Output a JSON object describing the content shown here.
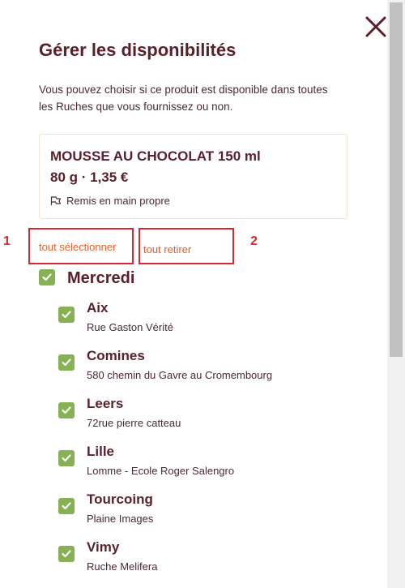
{
  "panel": {
    "title": "Gérer les disponibilités",
    "description": "Vous pouvez choisir si ce produit est disponible dans toutes les Ruches que vous fournissez ou non."
  },
  "product": {
    "name": "MOUSSE AU CHOCOLAT 150 ml",
    "price": "80 g · 1,35 €",
    "delivery": "Remis en main propre"
  },
  "actions": {
    "select_all": "tout sélectionner",
    "remove_all": "tout retirer"
  },
  "annotations": [
    "1",
    "2"
  ],
  "day": {
    "label": "Mercredi",
    "checked": true
  },
  "hives": [
    {
      "name": "Aix",
      "address": "Rue Gaston Vérité",
      "checked": true
    },
    {
      "name": "Comines",
      "address": "580 chemin du Gavre au Cromembourg",
      "checked": true
    },
    {
      "name": "Leers",
      "address": "72rue pierre catteau",
      "checked": true
    },
    {
      "name": "Lille",
      "address": "Lomme - Ecole Roger Salengro",
      "checked": true
    },
    {
      "name": "Tourcoing",
      "address": "Plaine Images",
      "checked": true
    },
    {
      "name": "Vimy",
      "address": "Ruche Melifera",
      "checked": true
    }
  ],
  "colors": {
    "title": "#5a1f2a",
    "accent_link": "#e8602c",
    "checkbox": "#86b155",
    "annotation": "#d9262f"
  }
}
